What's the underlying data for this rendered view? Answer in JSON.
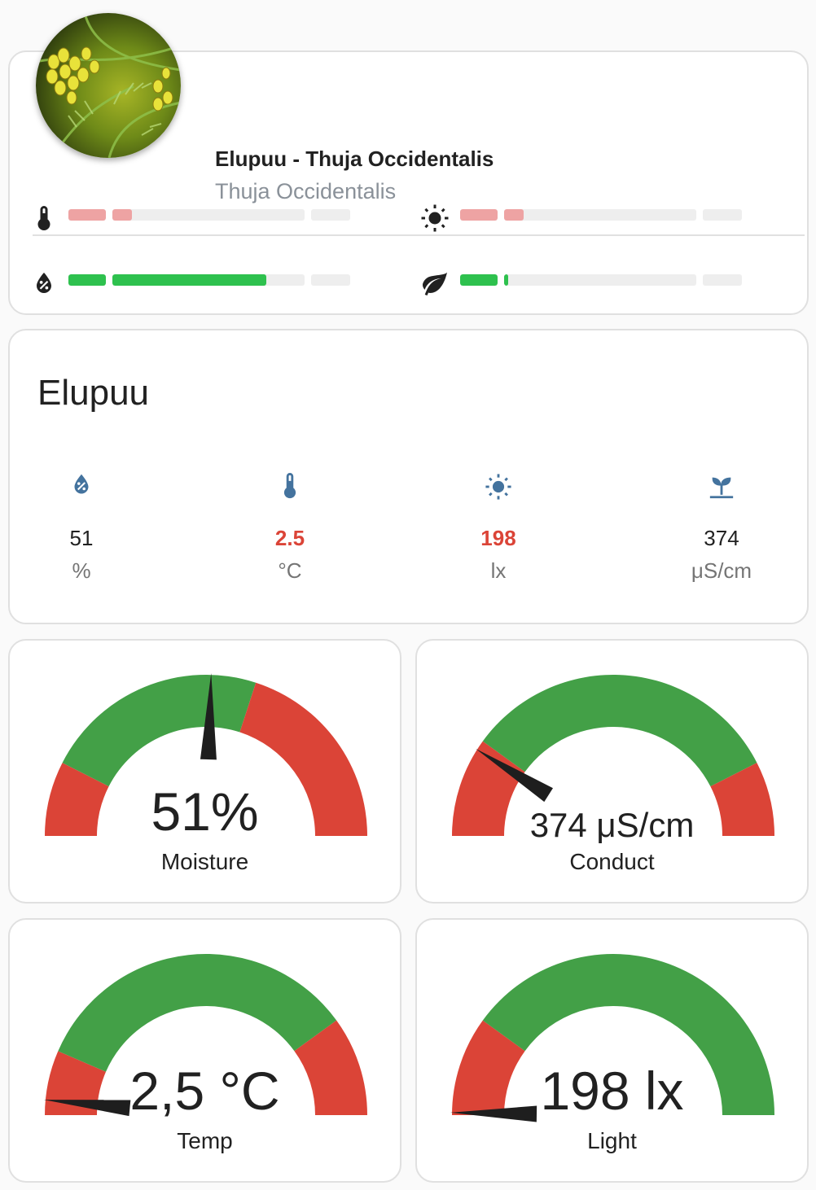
{
  "plant": {
    "name": "Elupuu - Thuja Occidentalis",
    "species": "Thuja Occidentalis",
    "attributes": [
      {
        "id": "temperature",
        "icon": "thermometer-icon",
        "level": 0.1,
        "status": "low"
      },
      {
        "id": "illuminance",
        "icon": "sun-icon",
        "level": 0.1,
        "status": "low"
      },
      {
        "id": "moisture",
        "icon": "water-percent-icon",
        "level": 0.8,
        "status": "ok"
      },
      {
        "id": "conductivity",
        "icon": "leaf-icon",
        "level": 0.02,
        "status": "ok"
      }
    ]
  },
  "sensors": {
    "title": "Elupuu",
    "items": [
      {
        "icon": "water-percent-icon",
        "value": "51",
        "unit": "%",
        "alert": false
      },
      {
        "icon": "thermometer-icon",
        "value": "2.5",
        "unit": "°C",
        "alert": true
      },
      {
        "icon": "sun-icon",
        "value": "198",
        "unit": "lx",
        "alert": true
      },
      {
        "icon": "sprout-icon",
        "value": "374",
        "unit": "μS/cm",
        "alert": false
      }
    ]
  },
  "gauges": [
    {
      "id": "moisture",
      "value_text": "51%",
      "name": "Moisture",
      "needle_fraction": 0.51,
      "segments": [
        {
          "from": 0,
          "to": 0.15,
          "color": "#db4437"
        },
        {
          "from": 0.15,
          "to": 0.6,
          "color": "#43a047"
        },
        {
          "from": 0.6,
          "to": 1,
          "color": "#db4437"
        }
      ]
    },
    {
      "id": "conduct",
      "value_text": "374 μS/cm",
      "name": "Conduct",
      "needle_fraction": 0.18,
      "segments": [
        {
          "from": 0,
          "to": 0.2,
          "color": "#db4437"
        },
        {
          "from": 0.2,
          "to": 0.85,
          "color": "#43a047"
        },
        {
          "from": 0.85,
          "to": 1,
          "color": "#db4437"
        }
      ]
    },
    {
      "id": "temp",
      "value_text": "2,5 °C",
      "name": "Temp",
      "needle_fraction": 0.03,
      "segments": [
        {
          "from": 0,
          "to": 0.13,
          "color": "#db4437"
        },
        {
          "from": 0.13,
          "to": 0.8,
          "color": "#43a047"
        },
        {
          "from": 0.8,
          "to": 1,
          "color": "#db4437"
        }
      ]
    },
    {
      "id": "light",
      "value_text": "198 lx",
      "name": "Light",
      "needle_fraction": 0.005,
      "segments": [
        {
          "from": 0,
          "to": 0.2,
          "color": "#db4437"
        },
        {
          "from": 0.2,
          "to": 1,
          "color": "#43a047"
        }
      ]
    }
  ],
  "colors": {
    "ok": "#2ec14e",
    "low": "#eea3a3",
    "alert": "#db4437",
    "icon_blue": "#44739e"
  }
}
